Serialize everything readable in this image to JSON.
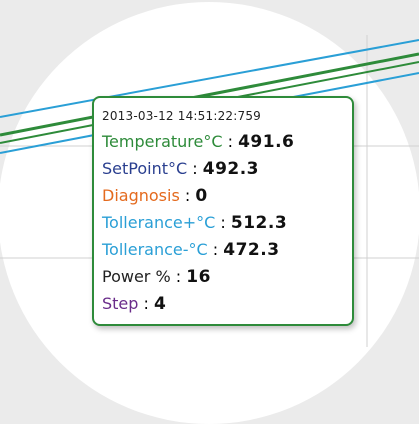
{
  "tooltip": {
    "timestamp": "2013-03-12 14:51:22:759",
    "rows": [
      {
        "label": "Temperature°C",
        "value": "491.6",
        "color": "#2e8b3a"
      },
      {
        "label": "SetPoint°C",
        "value": "492.3",
        "color": "#2a3f8f"
      },
      {
        "label": "Diagnosis",
        "value": "0",
        "color": "#e46a1e"
      },
      {
        "label": "Tollerance+°C",
        "value": "512.3",
        "color": "#2a9fd6"
      },
      {
        "label": "Tollerance-°C",
        "value": "472.3",
        "color": "#2a9fd6"
      },
      {
        "label": "Power %",
        "value": "16",
        "color": "#222222"
      },
      {
        "label": "Step",
        "value": "4",
        "color": "#6a2c8a"
      }
    ]
  },
  "colors": {
    "tooltip_border": "#2e8b3a",
    "temperature_line": "#2e8b3a",
    "tolerance_line": "#2a9fd6"
  }
}
